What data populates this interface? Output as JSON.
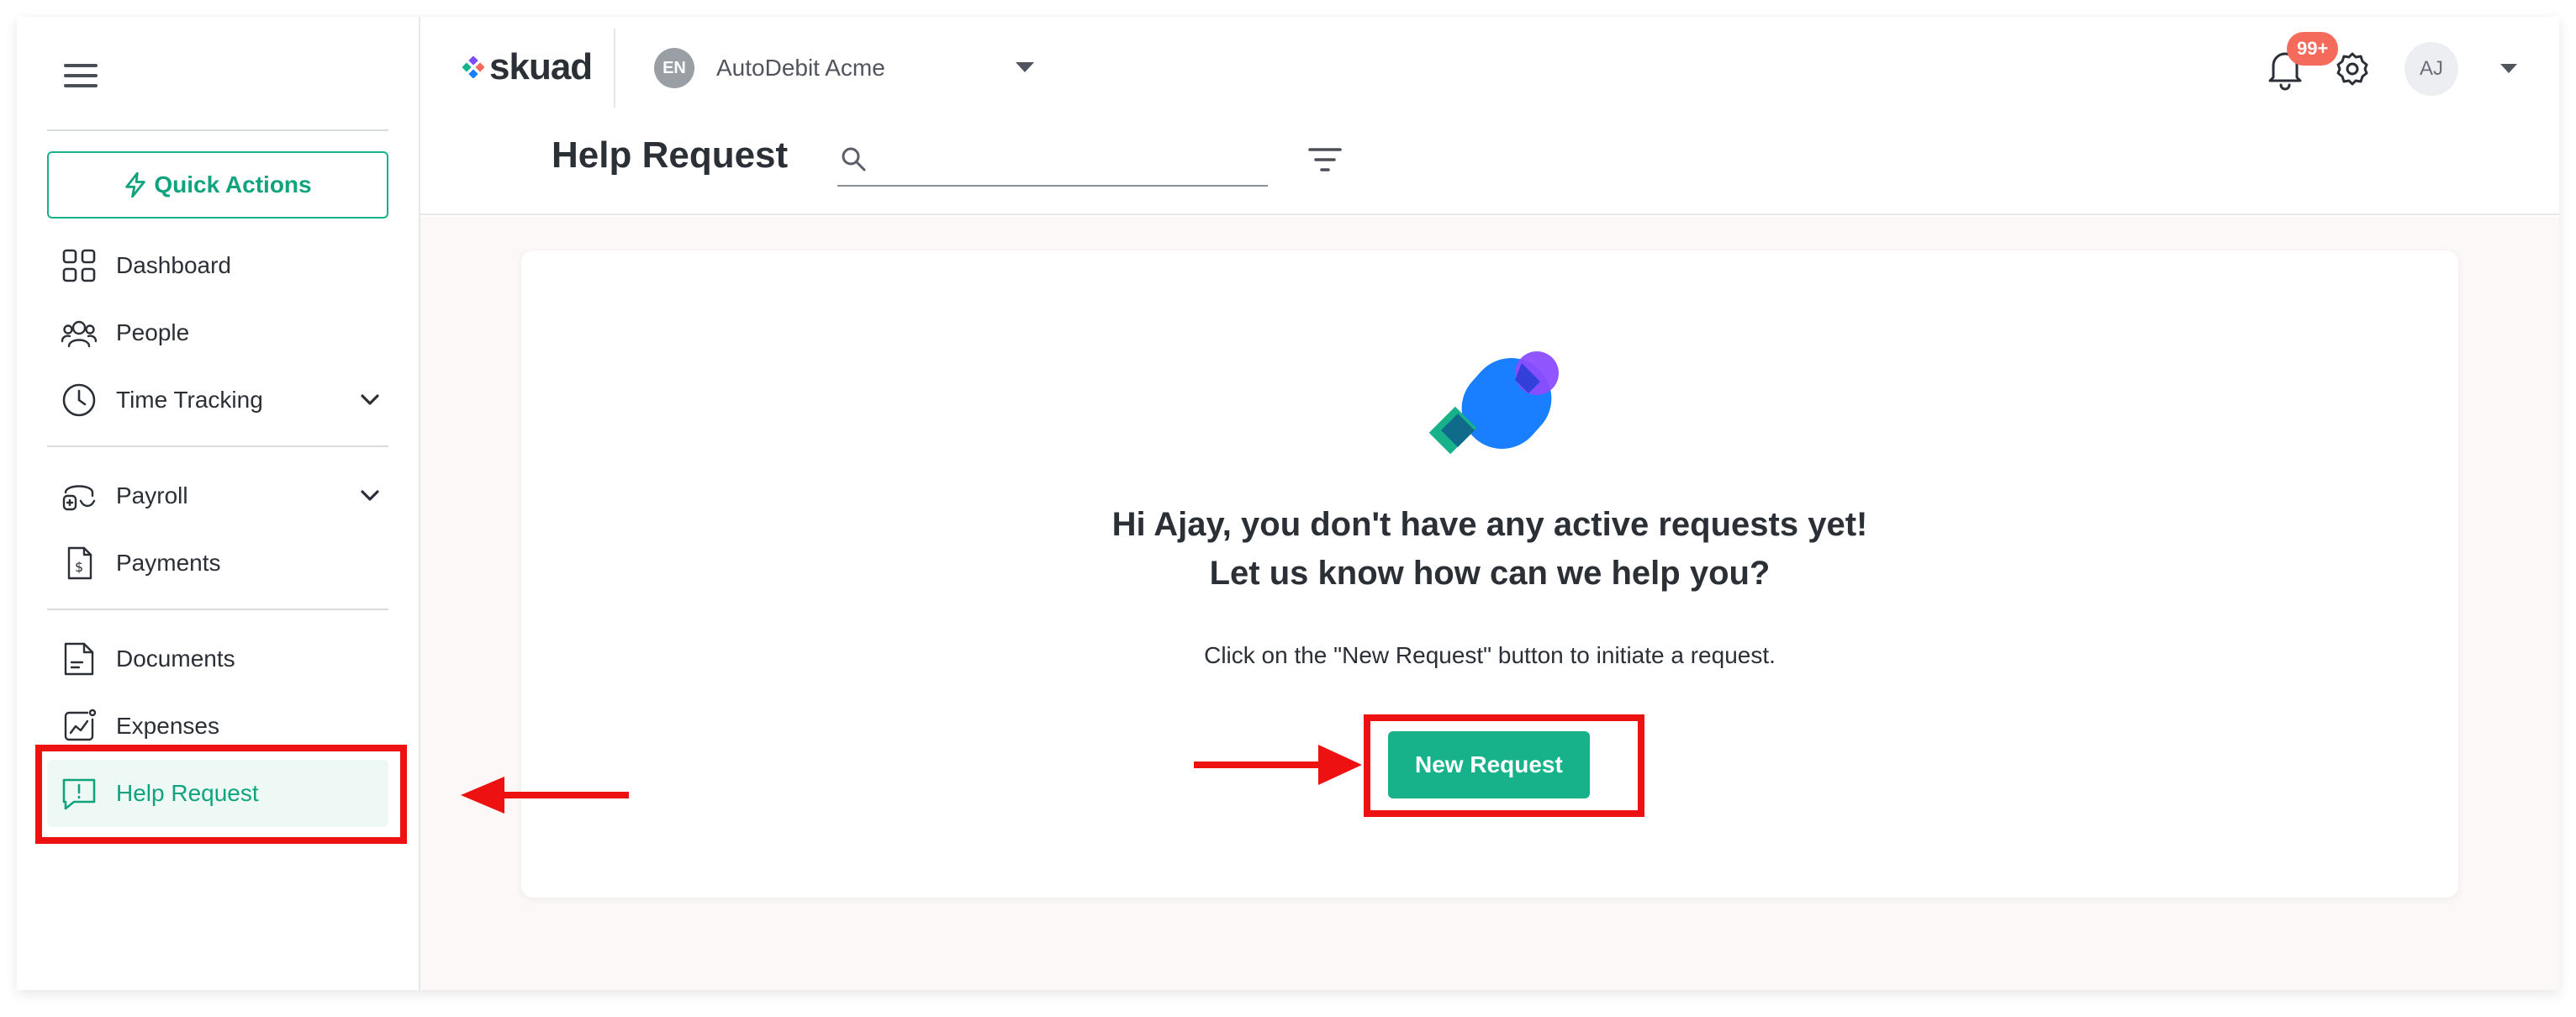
{
  "sidebar": {
    "quick_actions": "Quick Actions",
    "items": [
      {
        "label": "Dashboard",
        "icon": "grid-icon"
      },
      {
        "label": "People",
        "icon": "people-icon"
      },
      {
        "label": "Time Tracking",
        "icon": "clock-icon",
        "expandable": true
      },
      {
        "label": "Payroll",
        "icon": "payroll-icon",
        "expandable": true
      },
      {
        "label": "Payments",
        "icon": "payments-icon"
      },
      {
        "label": "Documents",
        "icon": "document-icon"
      },
      {
        "label": "Expenses",
        "icon": "expenses-icon"
      },
      {
        "label": "Help Request",
        "icon": "help-request-icon",
        "active": true
      }
    ]
  },
  "header": {
    "logo": "skuad",
    "company_badge": "EN",
    "company_name": "AutoDebit Acme",
    "notification_count": "99+",
    "avatar_initials": "AJ",
    "page_title": "Help Request",
    "search_placeholder": ""
  },
  "main": {
    "heading_line1": "Hi Ajay, you don't have any active requests yet!",
    "heading_line2": "Let us know how can we help you?",
    "subtext": "Click on the \"New Request\" button to initiate a request.",
    "new_request_button": "New Request"
  },
  "colors": {
    "brand_green": "#18b28a",
    "active_bg": "#eef8f4",
    "badge_red": "#f46b5b",
    "annotation_red": "#ee1111",
    "main_bg": "#fcf8f7"
  }
}
